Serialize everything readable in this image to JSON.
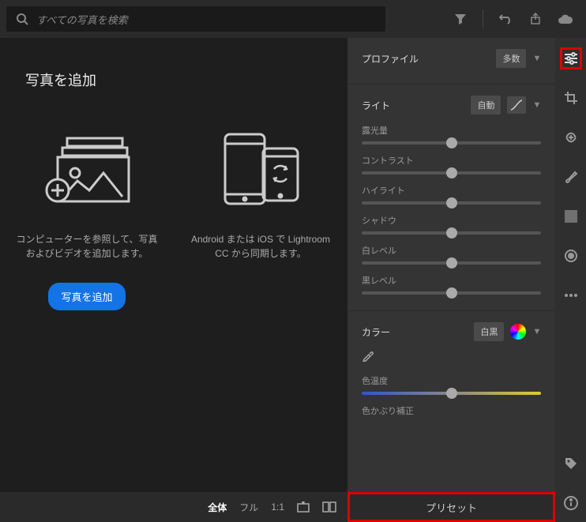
{
  "search": {
    "placeholder": "すべての写真を検索"
  },
  "empty": {
    "title": "写真を追加",
    "card1": "コンピューターを参照して、写真およびビデオを追加します。",
    "card2": "Android または iOS で Lightroom CC から同期します。",
    "button": "写真を追加"
  },
  "viewbar": {
    "full": "全体",
    "fl": "フル",
    "oneone": "1:1"
  },
  "panel": {
    "profile": {
      "title": "プロファイル",
      "value": "多数"
    },
    "light": {
      "title": "ライト",
      "auto": "自動",
      "exposure": "露光量",
      "contrast": "コントラスト",
      "highlights": "ハイライト",
      "shadows": "シャドウ",
      "whites": "白レベル",
      "blacks": "黒レベル"
    },
    "color": {
      "title": "カラー",
      "wb": "白黒",
      "temp": "色温度",
      "tint": "色かぶり補正"
    },
    "preset": "プリセット"
  }
}
